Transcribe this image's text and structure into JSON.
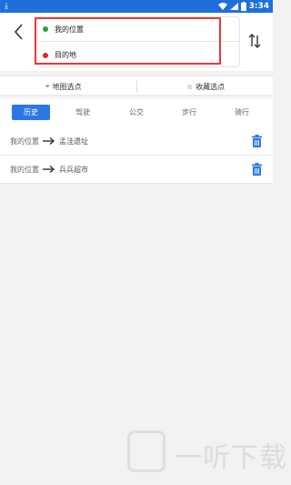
{
  "status_bar": {
    "download_icon": "download-icon",
    "wifi_icon": "wifi-icon",
    "signal_icon": "signal-icon",
    "battery_icon": "battery-icon",
    "time": "3:34"
  },
  "header": {
    "back_icon": "chevron-left-icon",
    "origin": "我的位置",
    "destination": "目的地",
    "origin_dot_color": "#2e9e3e",
    "destination_dot_color": "#d32f2f",
    "swap_icon": "swap-vertical-icon"
  },
  "pick_options": {
    "map_pick_label": "地图选点",
    "map_pick_icon": "location-pin-icon",
    "favorites_label": "收藏选点",
    "favorites_icon": "star-icon"
  },
  "tabs": [
    {
      "label": "历史",
      "active": true
    },
    {
      "label": "驾驶",
      "active": false
    },
    {
      "label": "公交",
      "active": false
    },
    {
      "label": "步行",
      "active": false
    },
    {
      "label": "骑行",
      "active": false
    }
  ],
  "history": [
    {
      "from": "我的位置",
      "to": "孟洼遗址"
    },
    {
      "from": "我的位置",
      "to": "兵兵超市"
    }
  ],
  "colors": {
    "accent": "#2b78e4",
    "status_bar": "#1e6fd9",
    "highlight_outline": "#e53935"
  },
  "watermark": {
    "text": "一听下载",
    "logo_icon": "yiting-logo-icon"
  }
}
